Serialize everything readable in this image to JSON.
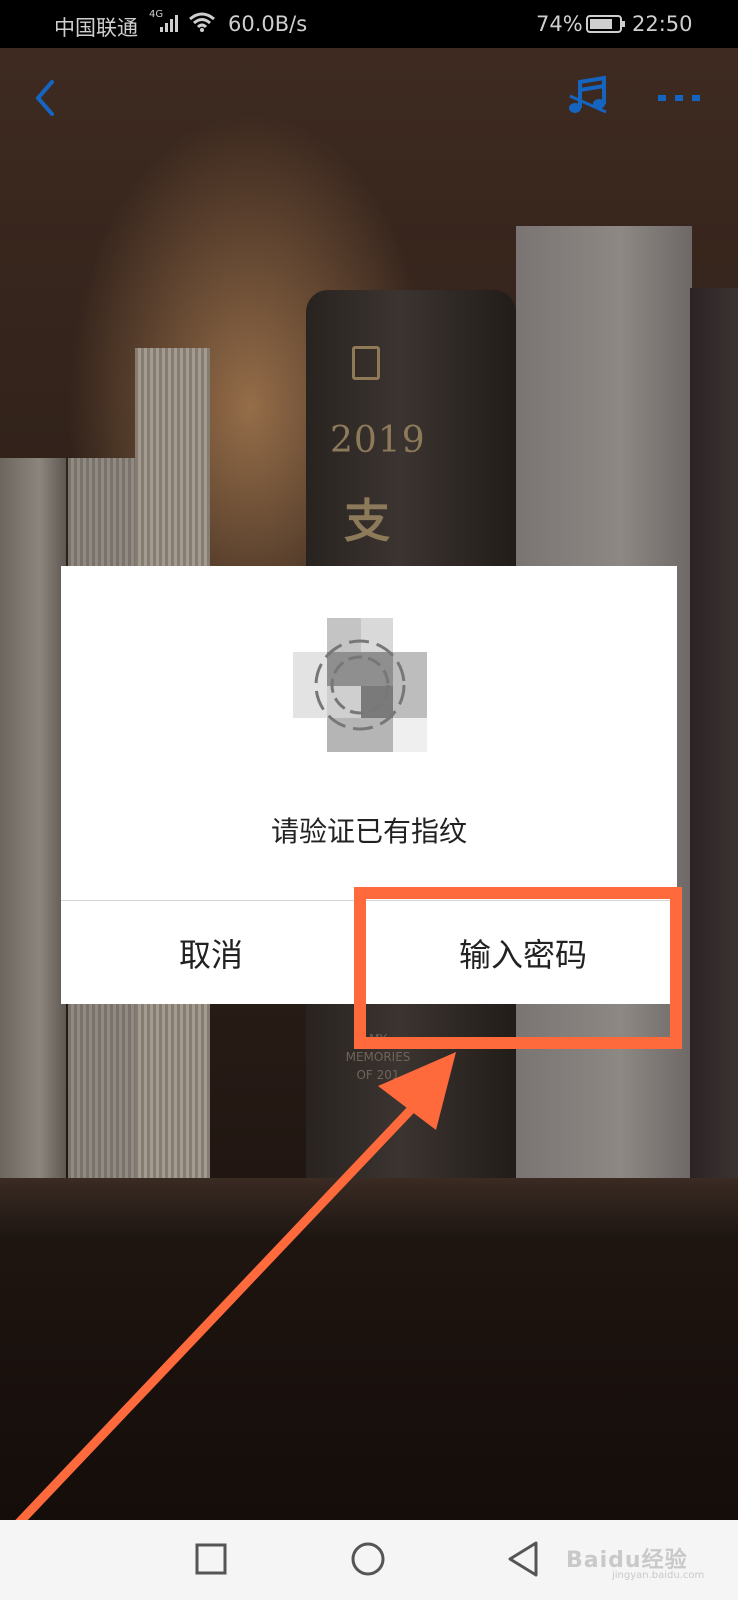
{
  "status_bar": {
    "carrier": "中国联通",
    "network_type": "4G",
    "speed": "60.0B/s",
    "battery_percent": "74%",
    "time": "22:50",
    "icons": [
      "signal-icon",
      "wifi-icon",
      "battery-icon"
    ]
  },
  "top_bar": {
    "icons": [
      "back-icon",
      "music-icon",
      "more-icon"
    ],
    "accent_color": "#1565c0"
  },
  "background": {
    "book_year": "2019",
    "book_title_char": "支",
    "book_subtitle_lines": [
      "MY",
      "MEMORIES",
      "OF 201"
    ]
  },
  "dialog": {
    "icon": "fingerprint-icon",
    "message": "请验证已有指纹",
    "cancel_label": "取消",
    "password_label": "输入密码"
  },
  "annotation": {
    "highlight_color": "#ff6a3d",
    "arrow_color": "#ff6a3d"
  },
  "nav_bar": {
    "icons": [
      "recent-apps-icon",
      "home-icon",
      "back-nav-icon"
    ],
    "watermark": "Baidu经验",
    "watermark_sub": "jingyan.baidu.com"
  }
}
